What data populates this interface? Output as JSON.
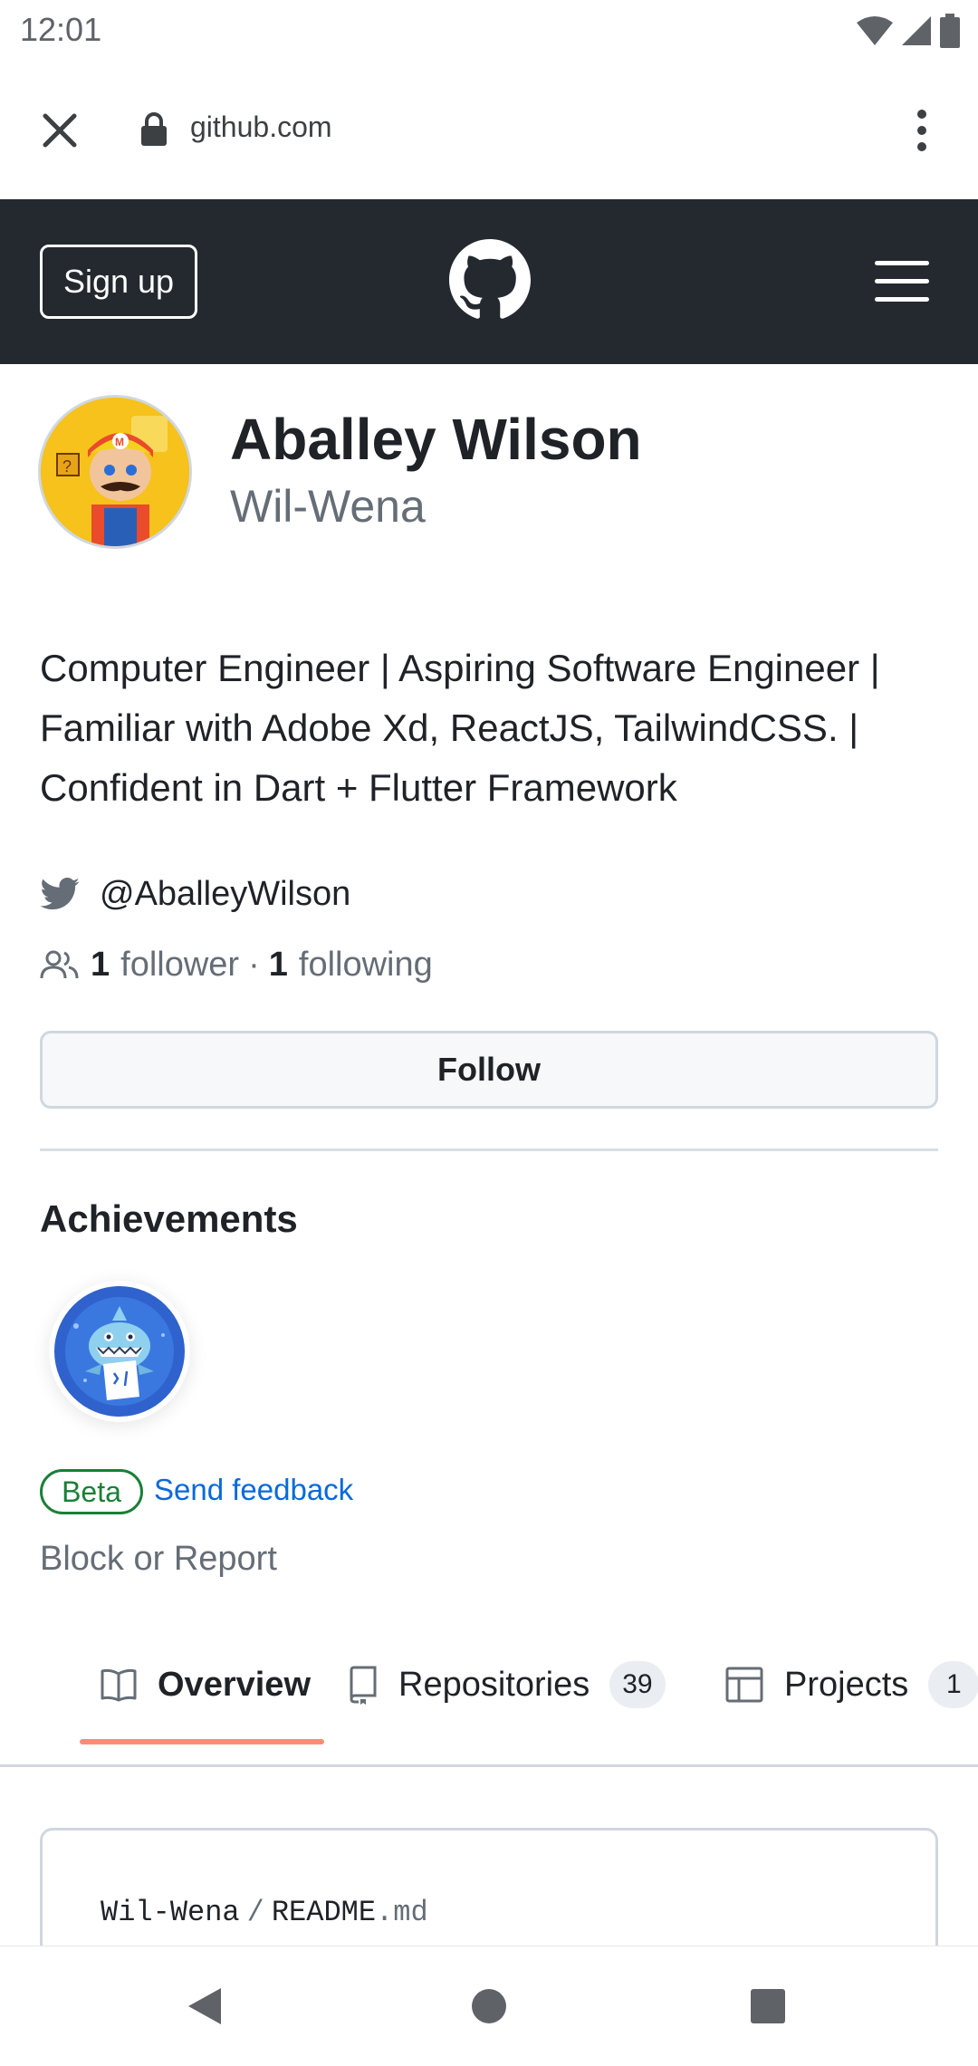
{
  "status_bar": {
    "time": "12:01"
  },
  "browser": {
    "url": "github.com"
  },
  "header": {
    "signup_label": "Sign up"
  },
  "profile": {
    "name": "Aballey Wilson",
    "login": "Wil-Wena",
    "bio_lines": [
      "Computer Engineer | Aspiring Software Engineer |",
      "Familiar with Adobe Xd, ReactJS, TailwindCSS. |",
      "Confident in Dart + Flutter Framework"
    ],
    "twitter": "@AballeyWilson",
    "followers_count": "1",
    "followers_label": "follower",
    "separator": "·",
    "following_count": "1",
    "following_label": "following",
    "follow_button": "Follow"
  },
  "achievements": {
    "title": "Achievements",
    "beta_label": "Beta",
    "feedback_label": "Send feedback"
  },
  "block_report": "Block or Report",
  "tabs": [
    {
      "label": "Overview",
      "icon": "book-icon",
      "active": true
    },
    {
      "label": "Repositories",
      "icon": "repo-icon",
      "count": "39"
    },
    {
      "label": "Projects",
      "icon": "table-icon",
      "count": "1"
    }
  ],
  "readme": {
    "owner": "Wil-Wena",
    "separator": "/",
    "file": "README",
    "ext": ".md"
  },
  "colors": {
    "header_bg": "#24292f",
    "tab_underline": "#fd8c73",
    "link": "#0969da",
    "beta": "#1a7f37"
  }
}
